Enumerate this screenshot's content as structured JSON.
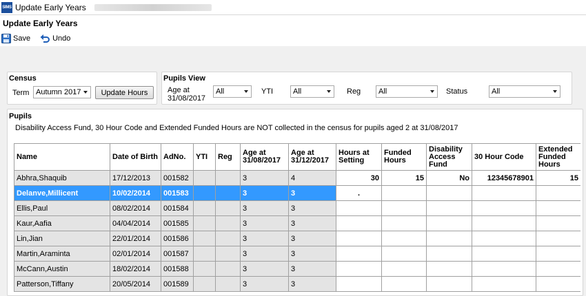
{
  "window": {
    "title": "Update Early Years"
  },
  "page": {
    "title": "Update Early Years"
  },
  "toolbar": {
    "save_label": "Save",
    "undo_label": "Undo"
  },
  "census": {
    "title": "Census",
    "term_label": "Term",
    "term_value": "Autumn 2017",
    "update_hours_label": "Update Hours"
  },
  "pupils_view": {
    "title": "Pupils View",
    "age_label_line1": "Age at",
    "age_label_line2": "31/08/2017",
    "age_value": "All",
    "yti_label": "YTI",
    "yti_value": "All",
    "reg_label": "Reg",
    "reg_value": "All",
    "status_label": "Status",
    "status_value": "All"
  },
  "pupils": {
    "title": "Pupils",
    "note": "Disability Access Fund, 30 Hour Code and Extended Funded Hours are NOT collected in the census for pupils aged 2 at 31/08/2017",
    "columns": [
      "Name",
      "Date of Birth",
      "AdNo.",
      "YTI",
      "Reg",
      "Age at 31/08/2017",
      "Age at 31/12/2017",
      "Hours at Setting",
      "Funded Hours",
      "Disability Access Fund",
      "30 Hour Code",
      "Extended Funded Hours"
    ],
    "rows": [
      {
        "name": "Abhra,Shaquib",
        "dob": "17/12/2013",
        "adno": "001582",
        "yti": "",
        "reg": "",
        "age1": "3",
        "age2": "4",
        "hours": "30",
        "funded": "15",
        "daf": "No",
        "code30": "12345678901",
        "extended": "15",
        "selected": false
      },
      {
        "name": "Delanve,Millicent",
        "dob": "10/02/2014",
        "adno": "001583",
        "yti": "",
        "reg": "",
        "age1": "3",
        "age2": "3",
        "hours": ".",
        "funded": "",
        "daf": "",
        "code30": "",
        "extended": "",
        "selected": true
      },
      {
        "name": "Ellis,Paul",
        "dob": "08/02/2014",
        "adno": "001584",
        "yti": "",
        "reg": "",
        "age1": "3",
        "age2": "3",
        "hours": "",
        "funded": "",
        "daf": "",
        "code30": "",
        "extended": "",
        "selected": false
      },
      {
        "name": "Kaur,Aafia",
        "dob": "04/04/2014",
        "adno": "001585",
        "yti": "",
        "reg": "",
        "age1": "3",
        "age2": "3",
        "hours": "",
        "funded": "",
        "daf": "",
        "code30": "",
        "extended": "",
        "selected": false
      },
      {
        "name": "Lin,Jian",
        "dob": "22/01/2014",
        "adno": "001586",
        "yti": "",
        "reg": "",
        "age1": "3",
        "age2": "3",
        "hours": "",
        "funded": "",
        "daf": "",
        "code30": "",
        "extended": "",
        "selected": false
      },
      {
        "name": "Martin,Araminta",
        "dob": "02/01/2014",
        "adno": "001587",
        "yti": "",
        "reg": "",
        "age1": "3",
        "age2": "3",
        "hours": "",
        "funded": "",
        "daf": "",
        "code30": "",
        "extended": "",
        "selected": false
      },
      {
        "name": "McCann,Austin",
        "dob": "18/02/2014",
        "adno": "001588",
        "yti": "",
        "reg": "",
        "age1": "3",
        "age2": "3",
        "hours": "",
        "funded": "",
        "daf": "",
        "code30": "",
        "extended": "",
        "selected": false
      },
      {
        "name": "Patterson,Tiffany",
        "dob": "20/05/2014",
        "adno": "001589",
        "yti": "",
        "reg": "",
        "age1": "3",
        "age2": "3",
        "hours": "",
        "funded": "",
        "daf": "",
        "code30": "",
        "extended": "",
        "selected": false
      }
    ]
  },
  "colors": {
    "selection": "#3399ff",
    "readonly_cell": "#e4e4e4",
    "app_icon": "#1b4f9c"
  },
  "icons": {
    "app": "sims-app-icon",
    "save": "floppy-disk-icon",
    "undo": "undo-arrow-icon"
  }
}
